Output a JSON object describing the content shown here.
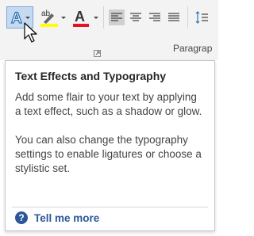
{
  "ribbon": {
    "text_effects_icon": "text-effects-icon",
    "highlight_label": "ab",
    "font_color_label": "A",
    "highlight_color": "#ffff00",
    "font_color": "#e81123",
    "selected_fill": "#c5daf0",
    "group_label": "Paragrap"
  },
  "tooltip": {
    "title": "Text Effects and Typography",
    "paragraph1": "Add some flair to your text by applying a text effect, such as a shadow or glow.",
    "paragraph2": "You can also change the typography settings to enable ligatures or choose a stylistic set.",
    "help_icon": "?",
    "link": "Tell me more",
    "link_color": "#2b579a"
  }
}
